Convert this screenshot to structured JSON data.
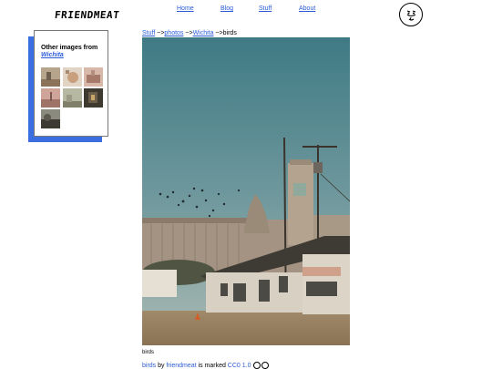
{
  "header": {
    "logo_text": "FRIENDMEAT",
    "nav": [
      {
        "label": "Home"
      },
      {
        "label": "Blog"
      },
      {
        "label": "Stuff"
      },
      {
        "label": "About"
      }
    ]
  },
  "breadcrumb": {
    "stuff": "Stuff",
    "sep1": " ~>",
    "photos": "photos",
    "sep2": " ~>",
    "wichita": "Wichita",
    "sep3": " ~>",
    "current": "birds"
  },
  "sidebar": {
    "heading": "Other images from",
    "link": "Wichita",
    "thumbnails": [
      {
        "name": "thumb-1"
      },
      {
        "name": "thumb-2"
      },
      {
        "name": "thumb-3"
      },
      {
        "name": "thumb-4"
      },
      {
        "name": "thumb-5"
      },
      {
        "name": "thumb-6"
      },
      {
        "name": "thumb-7"
      }
    ]
  },
  "photo": {
    "caption": "birds"
  },
  "license": {
    "title": "birds",
    "by": " by ",
    "author": "friendmeat",
    "marked": " is marked ",
    "license_name": "CC0 1.0"
  },
  "colors": {
    "link": "#2a5bd7",
    "card_shadow": "#3b6ee0",
    "sky": "#4e8490"
  }
}
